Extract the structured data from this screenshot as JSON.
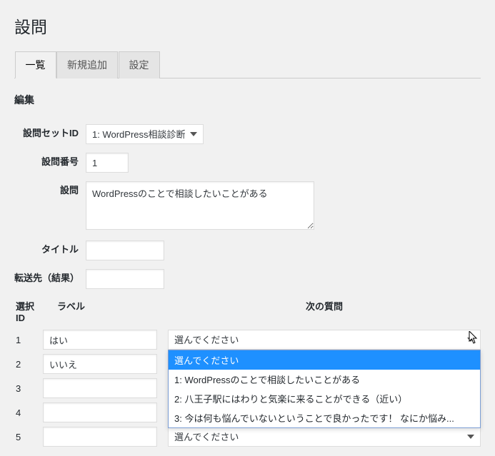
{
  "page": {
    "title": "設問"
  },
  "tabs": {
    "list": "一覧",
    "add": "新規追加",
    "settings": "設定"
  },
  "section": {
    "edit": "編集"
  },
  "form": {
    "labels": {
      "set_id": "設問セットID",
      "number": "設問番号",
      "question": "設問",
      "title": "タイトル",
      "forward": "転送先（結果）"
    },
    "values": {
      "set_id_selected": "1: WordPress相談診断",
      "number": "1",
      "question": "WordPressのことで相談したいことがある",
      "title": "",
      "forward": ""
    }
  },
  "choices": {
    "header": {
      "id": "選択ID",
      "label": "ラベル",
      "next": "次の質問"
    },
    "placeholder_next": "選んでください",
    "rows": [
      {
        "id": "1",
        "label": "はい",
        "next": "選んでください"
      },
      {
        "id": "2",
        "label": "いいえ",
        "next": "選んでください"
      },
      {
        "id": "3",
        "label": "",
        "next": ""
      },
      {
        "id": "4",
        "label": "",
        "next": ""
      },
      {
        "id": "5",
        "label": "",
        "next": "選んでください"
      }
    ],
    "dropdown_options": [
      "選んでください",
      "1: WordPressのことで相談したいことがある",
      "2: 八王子駅にはわりと気楽に来ることができる（近い）",
      "3: 今は何も悩んでいないということで良かったです！ なにか悩み..."
    ],
    "dropdown_selected_index": 0
  }
}
